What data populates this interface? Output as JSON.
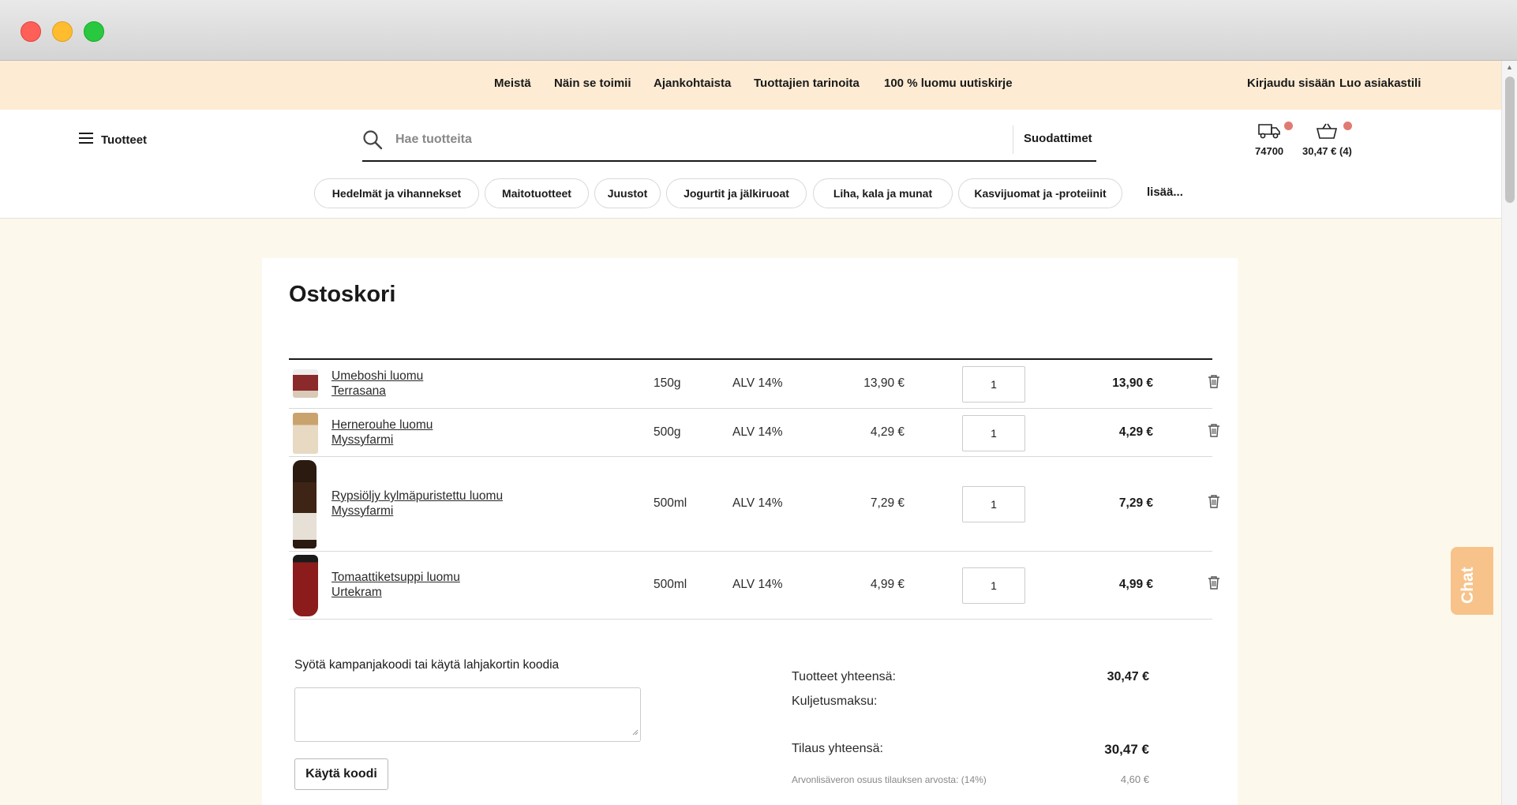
{
  "topnav": {
    "links": [
      "Meistä",
      "Näin se toimii",
      "Ajankohtaista",
      "Tuottajien tarinoita",
      "100 % luomu uutiskirje"
    ],
    "login": "Kirjaudu sisään",
    "register": "Luo asiakastili"
  },
  "header": {
    "menu_label": "Tuotteet",
    "search_placeholder": "Hae tuotteita",
    "filters_label": "Suodattimet",
    "delivery_postcode": "74700",
    "cart_summary": "30,47 € (4)"
  },
  "categories": [
    "Hedelmät ja vihannekset",
    "Maitotuotteet",
    "Juustot",
    "Jogurtit ja jälkiruoat",
    "Liha, kala ja munat",
    "Kasvijuomat ja -proteiinit"
  ],
  "categories_more": "lisää...",
  "cart": {
    "title": "Ostoskori",
    "items": [
      {
        "name": "Umeboshi luomu",
        "brand": "Terrasana",
        "size": "150g",
        "vat": "ALV 14%",
        "unit_price": "13,90 €",
        "quantity": "1",
        "total": "13,90 €"
      },
      {
        "name": "Hernerouhe luomu",
        "brand": "Myssyfarmi",
        "size": "500g",
        "vat": "ALV 14%",
        "unit_price": "4,29 €",
        "quantity": "1",
        "total": "4,29 €"
      },
      {
        "name": "Rypsiöljy kylmäpuristettu luomu",
        "brand": "Myssyfarmi",
        "size": "500ml",
        "vat": "ALV 14%",
        "unit_price": "7,29 €",
        "quantity": "1",
        "total": "7,29 €"
      },
      {
        "name": "Tomaattiketsuppi luomu",
        "brand": "Urtekram",
        "size": "500ml",
        "vat": "ALV 14%",
        "unit_price": "4,99 €",
        "quantity": "1",
        "total": "4,99 €"
      }
    ],
    "promo_label": "Syötä kampanjakoodi tai käytä lahjakortin koodia",
    "promo_button": "Käytä koodi",
    "summary": {
      "products_label": "Tuotteet yhteensä:",
      "products_value": "30,47 €",
      "shipping_label": "Kuljetusmaksu:",
      "order_label": "Tilaus yhteensä:",
      "order_value": "30,47 €",
      "vat_label": "Arvonlisäveron osuus tilauksen arvosta: (14%)",
      "vat_value": "4,60 €"
    }
  },
  "chat_label": "Chat",
  "colors": {
    "topbar": "#fdebd3",
    "page_bg": "#fdf8ec",
    "badge": "#e07b72",
    "chat": "#f7c38a"
  }
}
